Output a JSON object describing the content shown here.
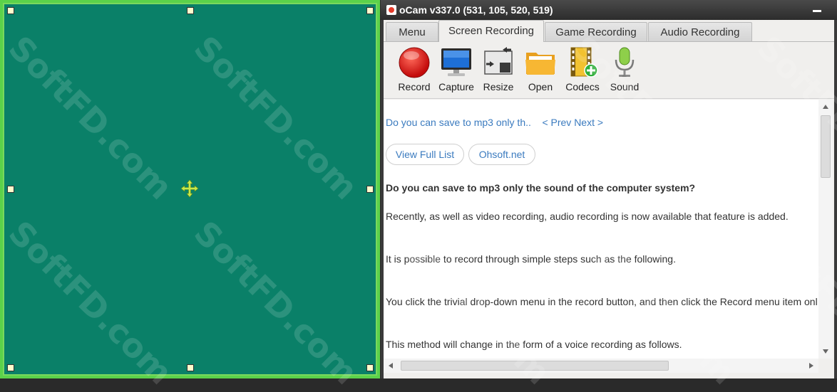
{
  "window": {
    "title": "oCam v337.0 (531, 105, 520, 519)"
  },
  "tabs": [
    {
      "label": "Menu",
      "active": false
    },
    {
      "label": "Screen Recording",
      "active": true
    },
    {
      "label": "Game Recording",
      "active": false
    },
    {
      "label": "Audio Recording",
      "active": false
    }
  ],
  "toolbar": [
    {
      "label": "Record",
      "icon": "record-icon"
    },
    {
      "label": "Capture",
      "icon": "monitor-icon"
    },
    {
      "label": "Resize",
      "icon": "resize-icon"
    },
    {
      "label": "Open",
      "icon": "folder-icon"
    },
    {
      "label": "Codecs",
      "icon": "film-icon"
    },
    {
      "label": "Sound",
      "icon": "microphone-icon"
    }
  ],
  "content": {
    "nav_link": "Do you can save to mp3 only th..",
    "prev_next": "< Prev Next >",
    "buttons": {
      "view_full_list": "View Full List",
      "ohsoft": "Ohsoft.net"
    },
    "heading": "Do you can save to mp3 only the sound of the computer system?",
    "paragraphs": [
      "Recently, as well as video recording, audio recording is now available that feature is added.",
      "It is possible to record through simple steps such as the following.",
      "You click the trivial drop-down menu in the record button, and then click the Record menu item onl",
      "This method will change in the form of a voice recording as follows."
    ]
  },
  "watermark": "SoftFD.com",
  "colors": {
    "capture_fill": "#0a8068",
    "capture_border": "#5bd24a",
    "link": "#3b7bbf",
    "title_bar": "#2c2c2c"
  }
}
